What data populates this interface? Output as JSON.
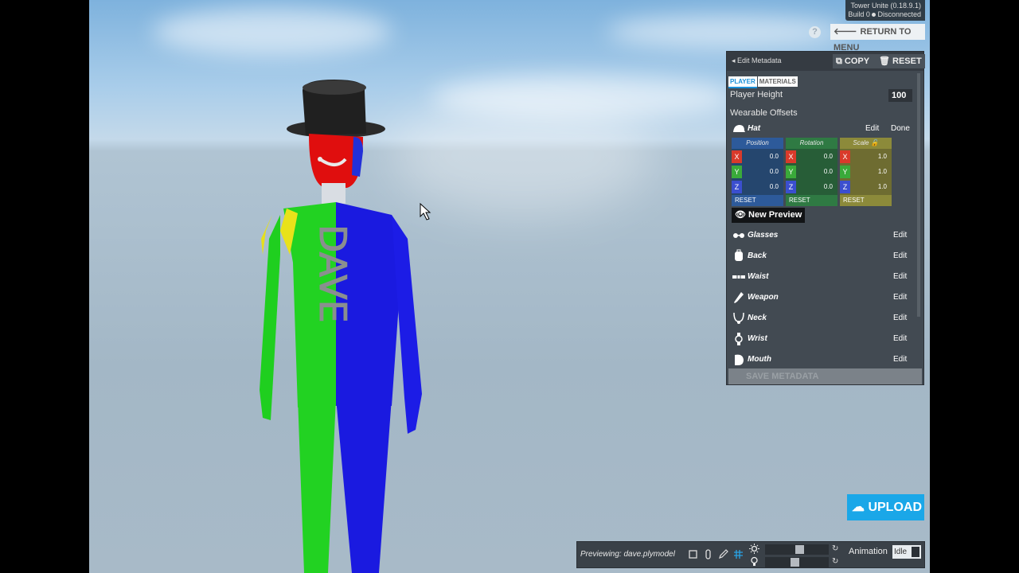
{
  "version": {
    "line1": "Tower Unite (0.18.9.1)",
    "line2_build": "Build 0",
    "line2_status": "Disconnected"
  },
  "help": {
    "label": "?"
  },
  "return_menu": {
    "label": "RETURN TO MENU"
  },
  "panel": {
    "title": "Edit Metadata",
    "copy_label": "COPY",
    "reset_label": "RESET",
    "tabs": [
      {
        "label": "PLAYER"
      },
      {
        "label": "MATERIALS"
      }
    ],
    "player_height_label": "Player Height",
    "player_height_value": "100",
    "wearable_offsets_label": "Wearable Offsets",
    "hat": {
      "label": "Hat",
      "edit": "Edit",
      "done": "Done"
    },
    "position": {
      "label": "Position",
      "x": "0.0",
      "y": "0.0",
      "z": "0.0",
      "reset": "RESET"
    },
    "rotation": {
      "label": "Rotation",
      "x": "0.0",
      "y": "0.0",
      "z": "0.0",
      "reset": "RESET"
    },
    "scale": {
      "label": "Scale",
      "x": "1.0",
      "y": "1.0",
      "z": "1.0",
      "reset": "RESET"
    },
    "axes": {
      "x": "X",
      "y": "Y",
      "z": "Z"
    },
    "new_preview_label": "New Preview",
    "wearables": [
      {
        "label": "Glasses",
        "edit": "Edit"
      },
      {
        "label": "Back",
        "edit": "Edit"
      },
      {
        "label": "Waist",
        "edit": "Edit"
      },
      {
        "label": "Weapon",
        "edit": "Edit"
      },
      {
        "label": "Neck",
        "edit": "Edit"
      },
      {
        "label": "Wrist",
        "edit": "Edit"
      },
      {
        "label": "Mouth",
        "edit": "Edit"
      }
    ],
    "save_label": "SAVE METADATA"
  },
  "upload": {
    "label": "UPLOAD"
  },
  "bottom_bar": {
    "previewing": "Previewing: dave.plymodel",
    "animation_label": "Animation",
    "animation_value": "Idle",
    "light_level": 0.55,
    "shadow_level": 0.46
  },
  "model": {
    "name_text": "DAVE"
  },
  "colors": {
    "accent": "#1aa7e8",
    "x_axis": "#d93a2b",
    "y_axis": "#3aaa3a",
    "z_axis": "#3b4fcf",
    "position": "#2d5a9a",
    "rotation": "#2f7a43",
    "scale": "#8c8a3a"
  }
}
